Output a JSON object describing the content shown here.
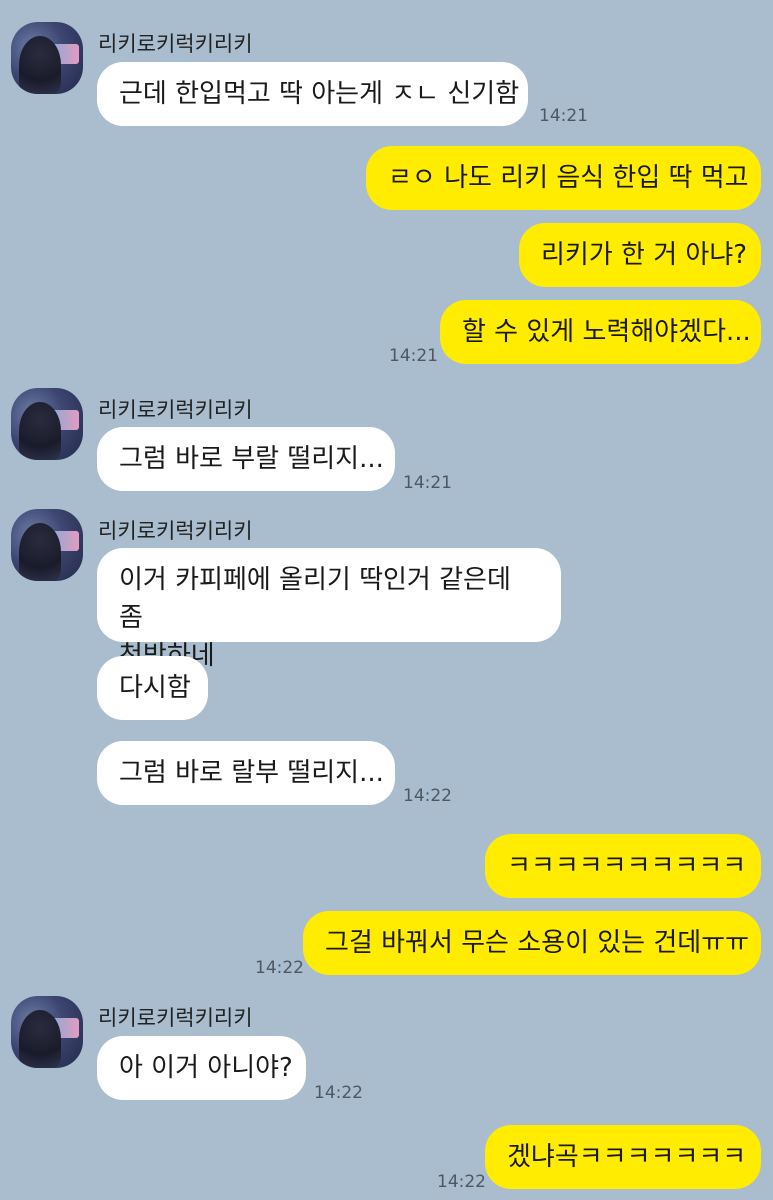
{
  "chat": {
    "sender_name": "리키로키럭키리키",
    "messages": [
      {
        "text": "근데 한입먹고 딱 아는게 ㅈㄴ 신기함",
        "time": "14:21"
      },
      {
        "text": "ㄹㅇ 나도 리키 음식 한입 딱 먹고"
      },
      {
        "text": "리키가 한 거 아냐?"
      },
      {
        "text": "할 수 있게 노력해야겠다...",
        "time": "14:21"
      },
      {
        "text": "그럼 바로 부랄 떨리지...",
        "time": "14:21"
      },
      {
        "text": "이거 카피페에 올리기 딱인거 같은데 좀",
        "text2": "천박하네"
      },
      {
        "text": "다시함"
      },
      {
        "text": "그럼 바로 랄부 떨리지...",
        "time": "14:22"
      },
      {
        "text": "ㅋㅋㅋㅋㅋㅋㅋㅋㅋㅋ"
      },
      {
        "text": "그걸 바꿔서 무슨 소용이 있는 건데ㅠㅠ",
        "time": "14:22"
      },
      {
        "text": "아 이거 아니야?",
        "time": "14:22"
      },
      {
        "text": "겠냐곡ㅋㅋㅋㅋㅋㅋㅋ",
        "time": "14:22"
      }
    ]
  }
}
